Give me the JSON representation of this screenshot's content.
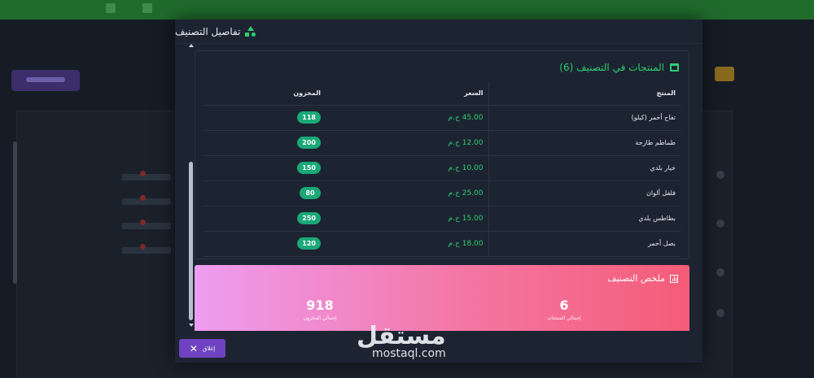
{
  "colors": {
    "accent_green": "#2ecc71",
    "badge_green": "#1aa877",
    "close_button": "#6f42c1",
    "summary_gradient": [
      "#ee9cf1",
      "#f476a3",
      "#f45c78"
    ],
    "modal_bg": "#1c2431"
  },
  "modal": {
    "title": "تفاصيل التصنيف",
    "title_icon": "shapes-icon"
  },
  "products": {
    "title": "المنتجات في التصنيف (6)",
    "title_icon": "archive-box-icon",
    "columns": [
      "المنتج",
      "السعر",
      "المخزون"
    ],
    "rows": [
      {
        "name": "تفاح أحمر (كيلو)",
        "price": "45.00 ج.م",
        "stock": "118"
      },
      {
        "name": "طماطم طازجة",
        "price": "12.00 ج.م",
        "stock": "200"
      },
      {
        "name": "خيار بلدي",
        "price": "10.00 ج.م",
        "stock": "150"
      },
      {
        "name": "فلفل ألوان",
        "price": "25.00 ج.م",
        "stock": "80"
      },
      {
        "name": "بطاطس بلدي",
        "price": "15.00 ج.م",
        "stock": "250"
      },
      {
        "name": "بصل أحمر",
        "price": "18.00 ج.م",
        "stock": "120"
      }
    ]
  },
  "summary": {
    "title": "ملخص التصنيف",
    "title_icon": "bar-chart-icon",
    "total_products_value": "6",
    "total_products_label": "إجمالي المنتجات",
    "total_stock_value": "918",
    "total_stock_label": "إجمالي المخزون"
  },
  "footer": {
    "close_label": "إغلاق",
    "close_icon": "close-icon"
  },
  "watermark": {
    "arabic": "مستقل",
    "latin": "mostaql.com"
  }
}
